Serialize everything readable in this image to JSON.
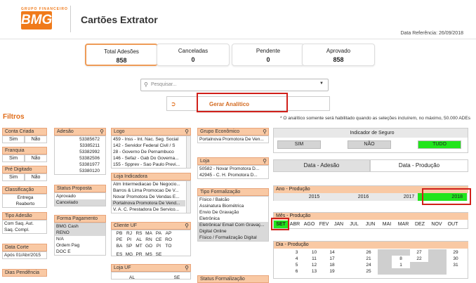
{
  "brand": {
    "group": "GRUPO FINANCEIRO",
    "name": "BMG"
  },
  "header": {
    "title": "Cartões Extrator",
    "data_referencia": "Data Referência: 26/09/2018"
  },
  "kpis": [
    {
      "label": "Total Adesões",
      "value": "858"
    },
    {
      "label": "Canceladas",
      "value": "0"
    },
    {
      "label": "Pendente",
      "value": "0"
    },
    {
      "label": "Aprovado",
      "value": "858"
    }
  ],
  "search": {
    "placeholder": "Pesquisar..."
  },
  "analitico": {
    "label": "Gerar Analítico",
    "note": "* O analítico somente será habilitado quando as seleções incluírem, no máximo, 50.000 ADEs"
  },
  "filtros": {
    "title": "Filtros",
    "conta_criada": {
      "title": "Conta Criada",
      "sim": "Sim",
      "nao": "Não"
    },
    "franquia": {
      "title": "Franquia",
      "sim": "Sim",
      "nao": "Não"
    },
    "pre_digitado": {
      "title": "Pré Digitado",
      "sim": "Sim",
      "nao": "Não"
    },
    "classificacao": {
      "title": "Classificação",
      "items": [
        "Entrega",
        "Reaberto"
      ]
    },
    "tipo_adesao": {
      "title": "Tipo Adesão",
      "items": [
        "Com Saq. Aut.",
        "Saq. Compl."
      ]
    },
    "data_corte": {
      "title": "Data Corte",
      "value": "Após 01/Abr/2015"
    },
    "dias_pendencia": {
      "title": "Dias Pendência"
    },
    "adesao": {
      "title": "Adesão",
      "items": [
        "53385672",
        "53385211",
        "53382992",
        "53382506",
        "53381977",
        "53380120"
      ]
    },
    "status_proposta": {
      "title": "Status Proposta",
      "items": [
        "Aprovado",
        "Cancelado"
      ]
    },
    "forma_pagamento": {
      "title": "Forma Pagamento",
      "items": [
        "BMG Cash",
        "RENO",
        "N/A",
        "Ordem Pag",
        "DOC E"
      ]
    },
    "logo": {
      "title": "Logo",
      "items": [
        "459 - Inss - Int. Nac. Seg. Social",
        "142 - Servidor Federal Civil / S",
        "28 - Governo De Pernambuco",
        "146 - Sefaz - Gab Do Governa...",
        "155 - Spprev - Sao Paulo Previ..."
      ]
    },
    "loja_indicadora": {
      "title": "Loja Indicadora",
      "items": [
        "Atm Intermediacao De Negocio...",
        "Barros & Lima Promocao De V...",
        "Novar Promotora De Vendas E...",
        "Portalnova Promotora De Vend...",
        "V. A. C. Prestadora De Servico..."
      ]
    },
    "cliente_uf": {
      "title": "Cliente UF",
      "rows": [
        [
          "PB",
          "RJ",
          "RS",
          "MA",
          "PA",
          "AP"
        ],
        [
          "PE",
          "PI",
          "AL",
          "RN",
          "CE",
          "RO"
        ],
        [
          "BA",
          "SP",
          "MT",
          "GO",
          "PI",
          "TO"
        ],
        [
          "ES",
          "MG",
          "PR",
          "MS",
          "SE",
          ""
        ]
      ]
    },
    "loja_uf": {
      "title": "Loja UF",
      "items": [
        "AL",
        "SE"
      ]
    },
    "grupo_economico": {
      "title": "Grupo Econômico",
      "items": [
        "Portalnova Promotora De Ven..."
      ]
    },
    "loja": {
      "title": "Loja",
      "items": [
        "50582 - Novar Promotora D...",
        "42945 - C. H. Promotora D..."
      ]
    },
    "tipo_formalizacao": {
      "title": "Tipo Formalização",
      "items": [
        "Físico / Balcão",
        "Assinatura Biométrica",
        "Envio De Gravação",
        "Eletrônica",
        "Eletrônica/ Email Com Gravaç...",
        "Digital Online",
        "Físico / Formalização Digital"
      ]
    },
    "status_formalizacao": {
      "title": "Status Formalização"
    }
  },
  "indicador": {
    "title": "Indicador de Seguro",
    "sim": "SIM",
    "nao": "NÃO",
    "tudo": "TUDO"
  },
  "tabs": {
    "adesao": "Data - Adesão",
    "producao": "Data - Produção"
  },
  "ano": {
    "title": "Ano - Produção",
    "items": [
      "2015",
      "2016",
      "2017",
      "2018"
    ]
  },
  "mes": {
    "title": "Mês - Produção",
    "items": [
      "SET",
      "ABR",
      "AGO",
      "FEV",
      "JAN",
      "JUL",
      "JUN",
      "MAI",
      "MAR",
      "DEZ",
      "NOV",
      "OUT"
    ]
  },
  "dia": {
    "title": "Dia - Produção",
    "rows": [
      [
        "3",
        "10",
        "14",
        "",
        "26",
        "",
        "",
        "27",
        "",
        "29"
      ],
      [
        "4",
        "11",
        "17",
        "",
        "21",
        "",
        "8",
        "22",
        "",
        "30"
      ],
      [
        "5",
        "12",
        "18",
        "",
        "24",
        "",
        "1",
        "",
        "",
        "31"
      ],
      [
        "6",
        "13",
        "19",
        "",
        "25",
        "",
        "",
        "",
        "",
        ""
      ]
    ]
  },
  "colors": {
    "accent": "#f07a1a",
    "header_bg": "#f9c9a4",
    "selected": "#22e51c",
    "highlight": "#d0201a"
  }
}
